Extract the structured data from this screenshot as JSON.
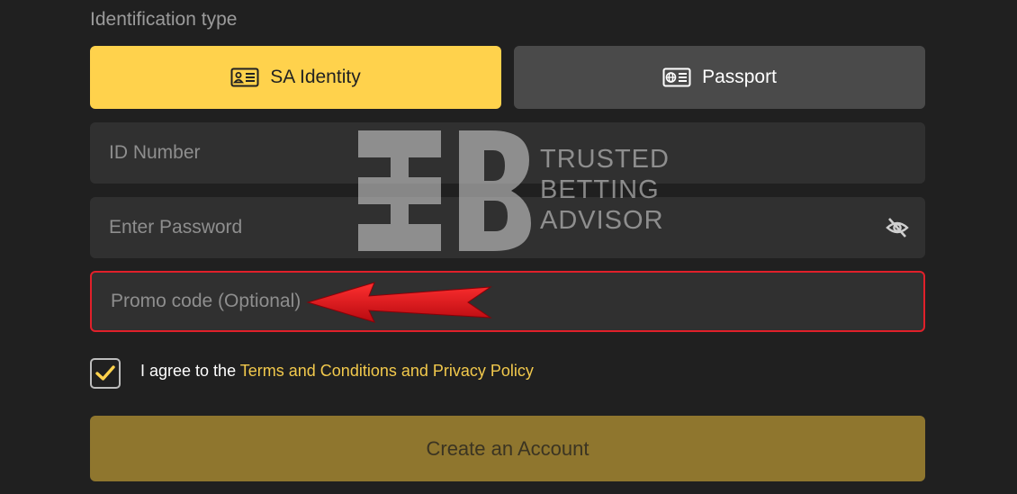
{
  "form": {
    "id_type_label": "Identification type",
    "id_types": [
      {
        "label": "SA Identity",
        "selected": true
      },
      {
        "label": "Passport",
        "selected": false
      }
    ],
    "id_number_placeholder": "ID Number",
    "password_placeholder": "Enter Password",
    "promo_placeholder": "Promo code (Optional)",
    "agree_prefix": "I agree to the ",
    "agree_link": "Terms and Conditions and Privacy Policy",
    "agree_checked": true,
    "create_button": "Create an Account"
  },
  "watermark": {
    "lines": [
      "TRUSTED",
      "BETTING",
      "ADVISOR"
    ]
  },
  "colors": {
    "background": "#202020",
    "accent": "#ffd24c",
    "link": "#f2c94c",
    "highlight_border": "#e0202a",
    "create_button_bg": "#8f762e"
  }
}
